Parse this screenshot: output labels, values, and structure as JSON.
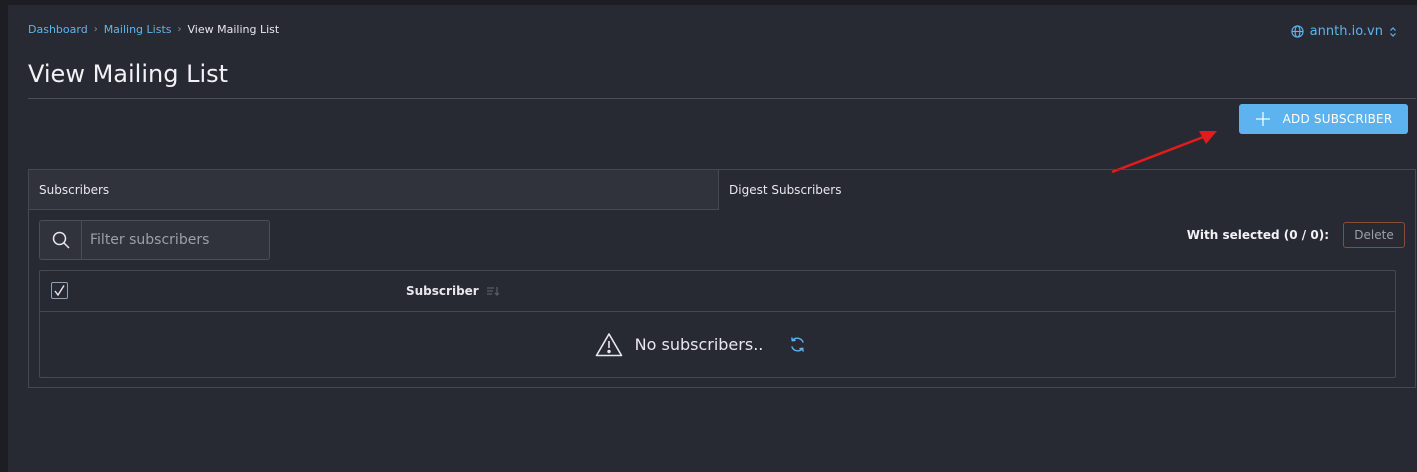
{
  "breadcrumb": {
    "dashboard": "Dashboard",
    "mailing_lists": "Mailing Lists",
    "current": "View Mailing List"
  },
  "site": {
    "name": "annth.io.vn"
  },
  "page": {
    "title": "View Mailing List"
  },
  "actions": {
    "add_subscriber": "ADD SUBSCRIBER"
  },
  "tabs": [
    {
      "label": "Subscribers"
    },
    {
      "label": "Digest Subscribers"
    }
  ],
  "filter": {
    "placeholder": "Filter subscribers"
  },
  "selection": {
    "label": "With selected (0 / 0):",
    "delete": "Delete"
  },
  "table": {
    "columns": [
      {
        "label": "Subscriber"
      }
    ],
    "empty_message": "No subscribers.."
  },
  "colors": {
    "accent": "#5cb3f0",
    "annotation_arrow": "#e21b1b",
    "background": "#272a33"
  },
  "icons": {
    "site": "globe-icon",
    "site_toggle": "chevron-updown-icon",
    "add": "plus-icon",
    "filter": "search-icon",
    "sort": "sort-icon",
    "empty": "warning-icon",
    "refresh": "refresh-icon"
  }
}
